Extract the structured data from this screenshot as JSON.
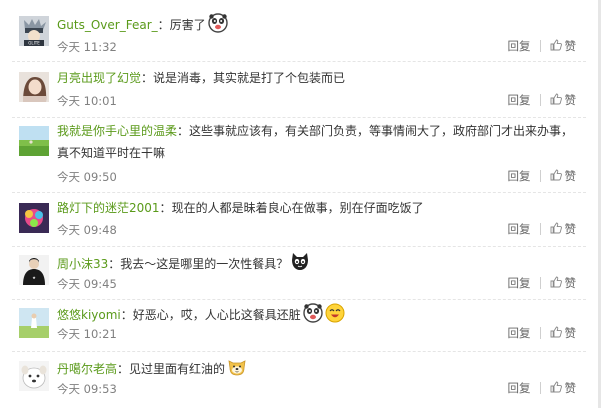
{
  "comments": [
    {
      "user": "Guts_Over_Fear_",
      "sep": "：",
      "text": "厉害了",
      "time": "今天 11:32",
      "emoji": [
        "panda-face-icon"
      ],
      "avatar": "avatar-kakashi"
    },
    {
      "user": "月亮出现了幻觉",
      "sep": "：",
      "text": "说是消毒，其实就是打了个包装而已",
      "time": "今天 10:01",
      "emoji": [],
      "avatar": "avatar-girl-portrait"
    },
    {
      "user": "我就是你手心里的温柔",
      "sep": "：",
      "text": "这些事就应该有，有关部门负责，等事情闹大了，政府部门才出来办事，",
      "text2": "真不知道平时在干嘛",
      "time": "今天 09:50",
      "emoji": [],
      "avatar": "avatar-meadow"
    },
    {
      "user": "路灯下的迷茫2001",
      "sep": "：",
      "text": "现在的人都是昧着良心在做事，别在仔面吃饭了",
      "time": "今天 09:48",
      "emoji": [],
      "avatar": "avatar-colorful-flower"
    },
    {
      "user": "周小沫33",
      "sep": "：",
      "text": "我去～这是哪里的一次性餐具？",
      "time": "今天 09:45",
      "emoji": [
        "black-cat-face-icon"
      ],
      "avatar": "avatar-black-tshirt"
    },
    {
      "user": "悠悠kiyomi",
      "sep": "：",
      "text": "好恶心，哎，人心比这餐具还脏",
      "time": "今天 10:21",
      "emoji": [
        "panda-face-icon",
        "laughing-face-icon"
      ],
      "avatar": "avatar-girl-field"
    },
    {
      "user": "丹噶尔老高",
      "sep": "：",
      "text": "见过里面有红油的",
      "time": "今天 09:53",
      "emoji": [
        "dog-face-icon"
      ],
      "avatar": "avatar-white-dog"
    }
  ],
  "actions": {
    "reply": "回复",
    "like": "赞"
  },
  "colors": {
    "username": "#5a9a1a",
    "time": "#808080",
    "action": "#666666"
  }
}
